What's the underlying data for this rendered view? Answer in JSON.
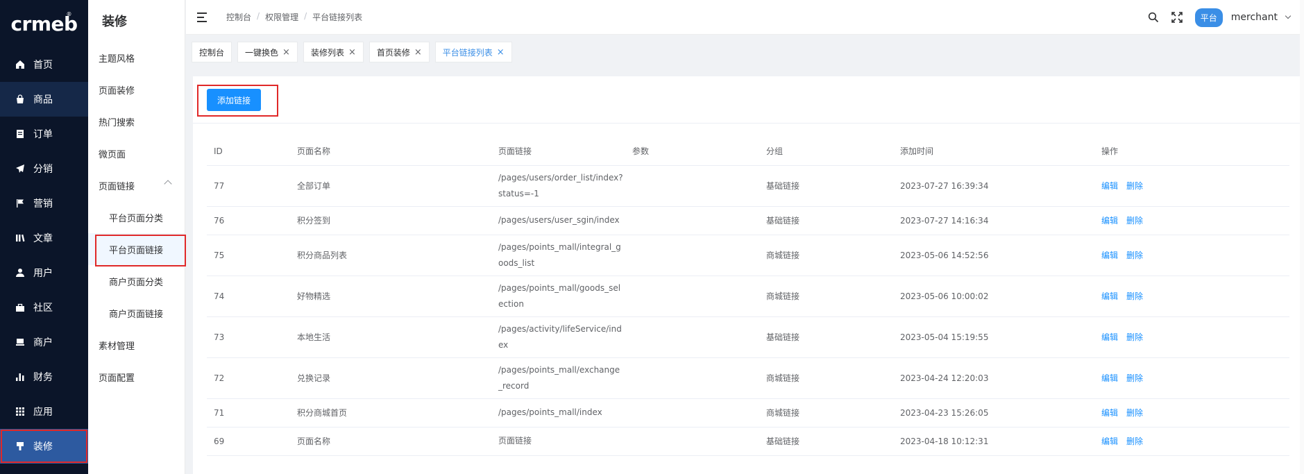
{
  "logo": {
    "text": "crmeb",
    "mark": "®"
  },
  "sidebar": {
    "items": [
      {
        "label": "首页",
        "icon": "home-icon"
      },
      {
        "label": "商品",
        "icon": "bag-icon"
      },
      {
        "label": "订单",
        "icon": "order-icon"
      },
      {
        "label": "分销",
        "icon": "send-icon"
      },
      {
        "label": "营销",
        "icon": "flag-icon"
      },
      {
        "label": "文章",
        "icon": "book-icon"
      },
      {
        "label": "用户",
        "icon": "user-icon"
      },
      {
        "label": "社区",
        "icon": "community-icon"
      },
      {
        "label": "商户",
        "icon": "shop-icon"
      },
      {
        "label": "财务",
        "icon": "chart-icon"
      },
      {
        "label": "应用",
        "icon": "grid-icon"
      },
      {
        "label": "装修",
        "icon": "brush-icon"
      }
    ]
  },
  "subnav": {
    "title": "装修",
    "items": [
      {
        "label": "主题风格"
      },
      {
        "label": "页面装修"
      },
      {
        "label": "热门搜索"
      },
      {
        "label": "微页面"
      },
      {
        "label": "页面链接"
      },
      {
        "label": "平台页面分类"
      },
      {
        "label": "平台页面链接"
      },
      {
        "label": "商户页面分类"
      },
      {
        "label": "商户页面链接"
      },
      {
        "label": "素材管理"
      },
      {
        "label": "页面配置"
      }
    ]
  },
  "header": {
    "breadcrumb": [
      "控制台",
      "权限管理",
      "平台链接列表"
    ],
    "separator": "/",
    "platform_badge": "平台",
    "username": "merchant"
  },
  "tabs": [
    {
      "label": "控制台"
    },
    {
      "label": "一键换色"
    },
    {
      "label": "装修列表"
    },
    {
      "label": "首页装修"
    },
    {
      "label": "平台链接列表"
    }
  ],
  "tab_close": "×",
  "toolbar": {
    "add_label": "添加链接"
  },
  "table": {
    "headers": [
      "ID",
      "页面名称",
      "页面链接",
      "参数",
      "分组",
      "添加时间",
      "操作"
    ],
    "rows": [
      {
        "id": "77",
        "name": "全部订单",
        "link": "/pages/users/order_list/index?status=-1",
        "param": "",
        "group": "基础链接",
        "time": "2023-07-27 16:39:34"
      },
      {
        "id": "76",
        "name": "积分签到",
        "link": "/pages/users/user_sgin/index",
        "param": "",
        "group": "基础链接",
        "time": "2023-07-27 14:16:34"
      },
      {
        "id": "75",
        "name": "积分商品列表",
        "link": "/pages/points_mall/integral_goods_list",
        "param": "",
        "group": "商城链接",
        "time": "2023-05-06 14:52:56"
      },
      {
        "id": "74",
        "name": "好物精选",
        "link": "/pages/points_mall/goods_selection",
        "param": "",
        "group": "商城链接",
        "time": "2023-05-06 10:00:02"
      },
      {
        "id": "73",
        "name": "本地生活",
        "link": "/pages/activity/lifeService/index",
        "param": "",
        "group": "基础链接",
        "time": "2023-05-04 15:19:55"
      },
      {
        "id": "72",
        "name": "兑换记录",
        "link": "/pages/points_mall/exchange_record",
        "param": "",
        "group": "商城链接",
        "time": "2023-04-24 12:20:03"
      },
      {
        "id": "71",
        "name": "积分商城首页",
        "link": "/pages/points_mall/index",
        "param": "",
        "group": "商城链接",
        "time": "2023-04-23 15:26:05"
      },
      {
        "id": "69",
        "name": "页面名称",
        "link": "页面链接",
        "param": "",
        "group": "基础链接",
        "time": "2023-04-18 10:12:31"
      }
    ],
    "edit_label": "编辑",
    "delete_label": "删除"
  },
  "colors": {
    "sidebar_bg": "#0b1529",
    "accent": "#1890ff",
    "highlight": "#e02828"
  }
}
